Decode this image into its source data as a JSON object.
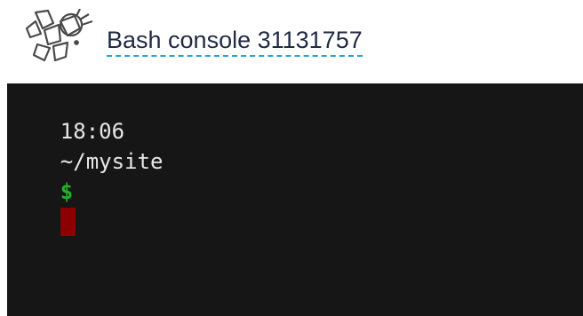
{
  "header": {
    "logo_icon": "pythonanywhere-logo-icon",
    "title": "Bash console 31131757"
  },
  "terminal": {
    "time": "18:06",
    "path": "~/mysite",
    "symbol": "$",
    "cursor_color": "#8b0000",
    "background_color": "#161616",
    "symbol_color": "#22b12a"
  }
}
